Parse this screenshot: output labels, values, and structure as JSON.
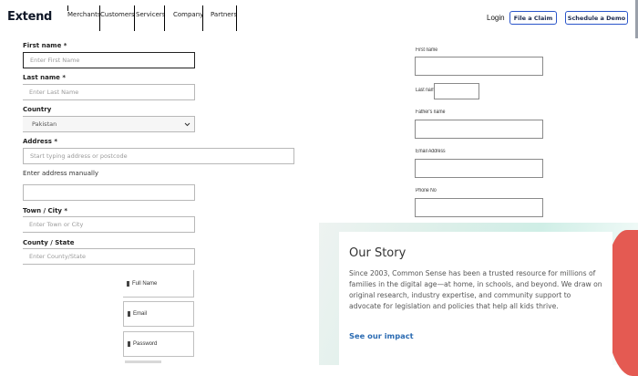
{
  "header": {
    "logo": "Extend",
    "nav": [
      "Merchants",
      "Customers",
      "Servicers",
      "Company",
      "Partners"
    ],
    "login": "Login",
    "file_claim": "File a Claim",
    "schedule_demo": "Schedule a Demo"
  },
  "form": {
    "first_name_label": "First name *",
    "first_name_placeholder": "Enter First Name",
    "last_name_label": "Last name *",
    "last_name_placeholder": "Enter Last Name",
    "country_label": "Country",
    "country_value": "Pakistan",
    "address_label": "Address *",
    "address_placeholder": "Start typing address or postcode",
    "manual_link": "Enter address manually",
    "town_label": "Town / City *",
    "town_placeholder": "Enter Town or City",
    "county_label": "County / State",
    "county_placeholder": "Enter County/State"
  },
  "signup": {
    "full_name": "Full Name",
    "email": "Email",
    "password": "Password"
  },
  "side_form": {
    "first_name": "First name",
    "last_name": "Last name",
    "fathers_name": "Father's name",
    "email_address": "Email Address",
    "phone_no": "Phone No"
  },
  "story": {
    "title": "Our Story",
    "body": "Since 2003, Common Sense has been a trusted resource for millions of families in the digital age—at home, in schools, and beyond. We draw on original research, industry expertise, and community support to advocate for legislation and policies that help all kids thrive.",
    "link": "See our impact"
  },
  "colors": {
    "button_border": "#2a55c9",
    "link": "#2b6bb2",
    "accent_blob": "#e45a52"
  }
}
